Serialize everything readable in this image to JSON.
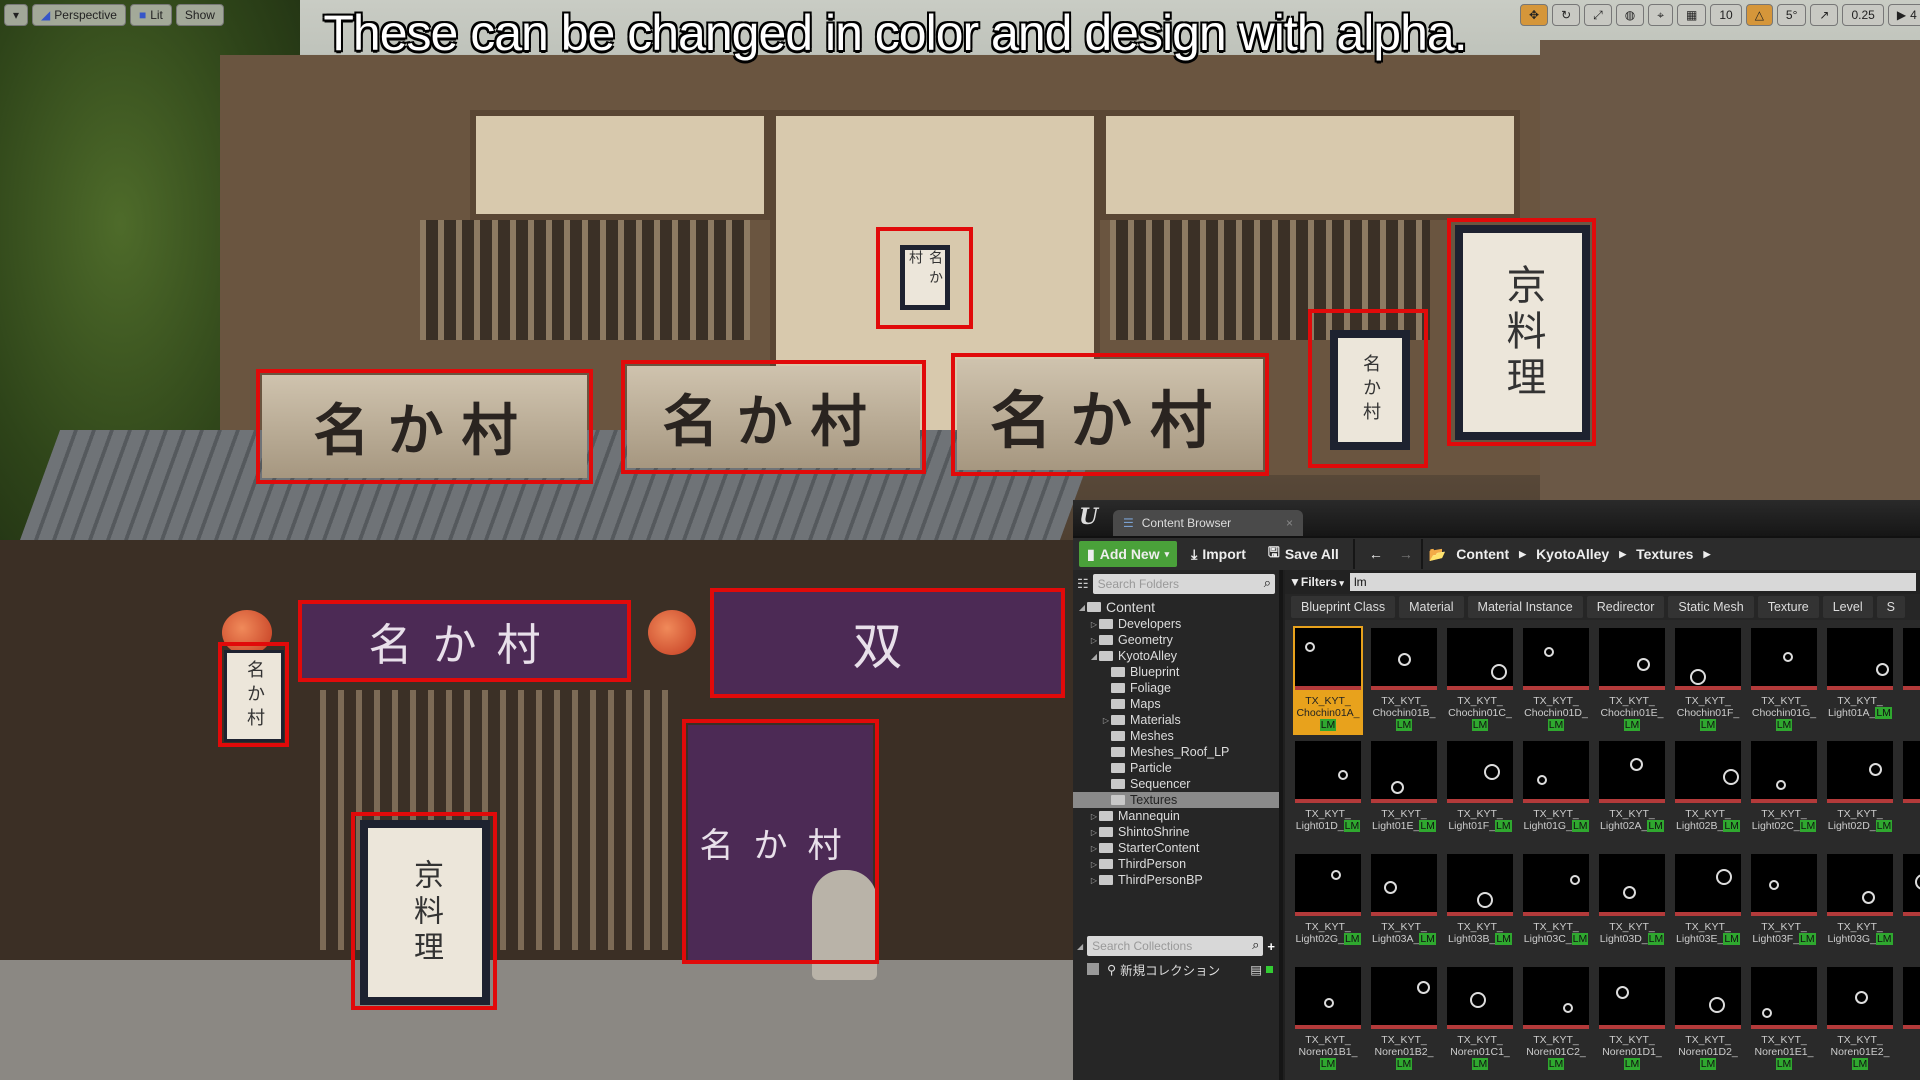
{
  "headline": "These can be changed in color and design with alpha.",
  "viewport_left": {
    "buttons": [
      "Perspective",
      "Lit",
      "Show"
    ]
  },
  "viewport_right": {
    "grid_snap": "10",
    "rotate_snap": "5°",
    "scale_snap": "0.25",
    "camera_speed": "4"
  },
  "scene_signs": {
    "shop_name": "名か村",
    "kyo_ryori": "京料理",
    "noren_crest": "双"
  },
  "content_browser": {
    "tab_label": "Content Browser",
    "toolbar": {
      "add_new": "Add New",
      "import": "Import",
      "save_all": "Save All"
    },
    "breadcrumb": [
      "Content",
      "KyotoAlley",
      "Textures"
    ],
    "search_folders_placeholder": "Search Folders",
    "filters_label": "Filters",
    "filter_text": "lm",
    "type_filters": [
      "Blueprint Class",
      "Material",
      "Material Instance",
      "Redirector",
      "Static Mesh",
      "Texture",
      "Level",
      "S"
    ],
    "tree": [
      {
        "label": "Content",
        "depth": 0,
        "arrow": "◢"
      },
      {
        "label": "Developers",
        "depth": 1,
        "arrow": "▷"
      },
      {
        "label": "Geometry",
        "depth": 1,
        "arrow": "▷"
      },
      {
        "label": "KyotoAlley",
        "depth": 1,
        "arrow": "◢"
      },
      {
        "label": "Blueprint",
        "depth": 2,
        "arrow": ""
      },
      {
        "label": "Foliage",
        "depth": 2,
        "arrow": ""
      },
      {
        "label": "Maps",
        "depth": 2,
        "arrow": ""
      },
      {
        "label": "Materials",
        "depth": 2,
        "arrow": "▷"
      },
      {
        "label": "Meshes",
        "depth": 2,
        "arrow": ""
      },
      {
        "label": "Meshes_Roof_LP",
        "depth": 2,
        "arrow": ""
      },
      {
        "label": "Particle",
        "depth": 2,
        "arrow": ""
      },
      {
        "label": "Sequencer",
        "depth": 2,
        "arrow": ""
      },
      {
        "label": "Textures",
        "depth": 2,
        "arrow": "",
        "selected": true
      },
      {
        "label": "Mannequin",
        "depth": 1,
        "arrow": "▷"
      },
      {
        "label": "ShintoShrine",
        "depth": 1,
        "arrow": "▷"
      },
      {
        "label": "StarterContent",
        "depth": 1,
        "arrow": "▷"
      },
      {
        "label": "ThirdPerson",
        "depth": 1,
        "arrow": "▷"
      },
      {
        "label": "ThirdPersonBP",
        "depth": 1,
        "arrow": "▷"
      }
    ],
    "search_collections_placeholder": "Search Collections",
    "collection_item": "新規コレクション",
    "assets": [
      {
        "l1": "TX_KYT_",
        "l2": "Chochin01A_",
        "badge": "LM",
        "inline": false,
        "selected": true
      },
      {
        "l1": "TX_KYT_",
        "l2": "Chochin01B_",
        "badge": "LM",
        "inline": false
      },
      {
        "l1": "TX_KYT_",
        "l2": "Chochin01C_",
        "badge": "LM",
        "inline": false
      },
      {
        "l1": "TX_KYT_",
        "l2": "Chochin01D_",
        "badge": "LM",
        "inline": false
      },
      {
        "l1": "TX_KYT_",
        "l2": "Chochin01E_",
        "badge": "LM",
        "inline": false
      },
      {
        "l1": "TX_KYT_",
        "l2": "Chochin01F_",
        "badge": "LM",
        "inline": false
      },
      {
        "l1": "TX_KYT_",
        "l2": "Chochin01G_",
        "badge": "LM",
        "inline": false
      },
      {
        "l1": "TX_KYT_",
        "l2": "Light01A_",
        "badge": "LM",
        "inline": true
      },
      {
        "l1": "T",
        "l2": "Ligh",
        "badge": "",
        "inline": true
      },
      {
        "l1": "TX_KYT_",
        "l2": "Light01D_",
        "badge": "LM",
        "inline": true
      },
      {
        "l1": "TX_KYT_",
        "l2": "Light01E_",
        "badge": "LM",
        "inline": true
      },
      {
        "l1": "TX_KYT_",
        "l2": "Light01F_",
        "badge": "LM",
        "inline": true
      },
      {
        "l1": "TX_KYT_",
        "l2": "Light01G_",
        "badge": "LM",
        "inline": true
      },
      {
        "l1": "TX_KYT_",
        "l2": "Light02A_",
        "badge": "LM",
        "inline": true
      },
      {
        "l1": "TX_KYT_",
        "l2": "Light02B_",
        "badge": "LM",
        "inline": true
      },
      {
        "l1": "TX_KYT_",
        "l2": "Light02C_",
        "badge": "LM",
        "inline": true
      },
      {
        "l1": "TX_KYT_",
        "l2": "Light02D_",
        "badge": "LM",
        "inline": true
      },
      {
        "l1": "T",
        "l2": "Ligh",
        "badge": "",
        "inline": true
      },
      {
        "l1": "TX_KYT_",
        "l2": "Light02G_",
        "badge": "LM",
        "inline": true
      },
      {
        "l1": "TX_KYT_",
        "l2": "Light03A_",
        "badge": "LM",
        "inline": true
      },
      {
        "l1": "TX_KYT_",
        "l2": "Light03B_",
        "badge": "LM",
        "inline": true
      },
      {
        "l1": "TX_KYT_",
        "l2": "Light03C_",
        "badge": "LM",
        "inline": true
      },
      {
        "l1": "TX_KYT_",
        "l2": "Light03D_",
        "badge": "LM",
        "inline": true
      },
      {
        "l1": "TX_KYT_",
        "l2": "Light03E_",
        "badge": "LM",
        "inline": true
      },
      {
        "l1": "TX_KYT_",
        "l2": "Light03F_",
        "badge": "LM",
        "inline": true
      },
      {
        "l1": "TX_KYT_",
        "l2": "Light03G_",
        "badge": "LM",
        "inline": true
      },
      {
        "l1": "T",
        "l2": "Nor",
        "badge": "",
        "inline": true
      },
      {
        "l1": "TX_KYT_",
        "l2": "Noren01B1_",
        "badge": "LM",
        "inline": false
      },
      {
        "l1": "TX_KYT_",
        "l2": "Noren01B2_",
        "badge": "LM",
        "inline": false
      },
      {
        "l1": "TX_KYT_",
        "l2": "Noren01C1_",
        "badge": "LM",
        "inline": false
      },
      {
        "l1": "TX_KYT_",
        "l2": "Noren01C2_",
        "badge": "LM",
        "inline": false
      },
      {
        "l1": "TX_KYT_",
        "l2": "Noren01D1_",
        "badge": "LM",
        "inline": false
      },
      {
        "l1": "TX_KYT_",
        "l2": "Noren01D2_",
        "badge": "LM",
        "inline": false
      },
      {
        "l1": "TX_KYT_",
        "l2": "Noren01E1_",
        "badge": "LM",
        "inline": false
      },
      {
        "l1": "TX_KYT_",
        "l2": "Noren01E2_",
        "badge": "LM",
        "inline": false
      },
      {
        "l1": "T",
        "l2": "No",
        "badge": "",
        "inline": false
      }
    ]
  },
  "colors": {
    "highlight_box": "#e10a0a",
    "add_new_green": "#4aa13a",
    "selected_tile": "#e8a21c",
    "lm_badge": "#2fa82f"
  }
}
